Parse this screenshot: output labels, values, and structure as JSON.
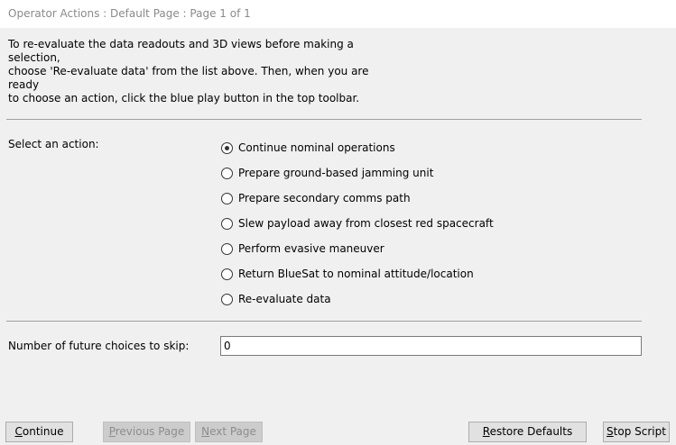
{
  "window": {
    "title": "Operator Actions : Default Page : Page 1 of 1"
  },
  "instructions": "To re-evaluate the data readouts and 3D views before making a selection,\nchoose 'Re-evaluate data' from the list above. Then, when you are ready\nto choose an action, click the blue play button in the top toolbar.",
  "action_select": {
    "label": "Select an action:",
    "selected_index": 0,
    "options": [
      "Continue nominal operations",
      "Prepare ground-based jamming unit",
      "Prepare secondary comms path",
      "Slew payload away from closest red spacecraft",
      "Perform evasive maneuver",
      "Return BlueSat to nominal attitude/location",
      "Re-evaluate data"
    ]
  },
  "skip_field": {
    "label": "Number of future choices to skip:",
    "value": "0"
  },
  "buttons": {
    "continue": {
      "first": "C",
      "rest": "ontinue"
    },
    "previous": {
      "first": "P",
      "rest": "revious Page"
    },
    "next": {
      "first": "N",
      "rest": "ext Page"
    },
    "restore": {
      "first": "R",
      "rest": "estore Defaults"
    },
    "stop": {
      "first": "S",
      "rest": "top Script"
    }
  }
}
